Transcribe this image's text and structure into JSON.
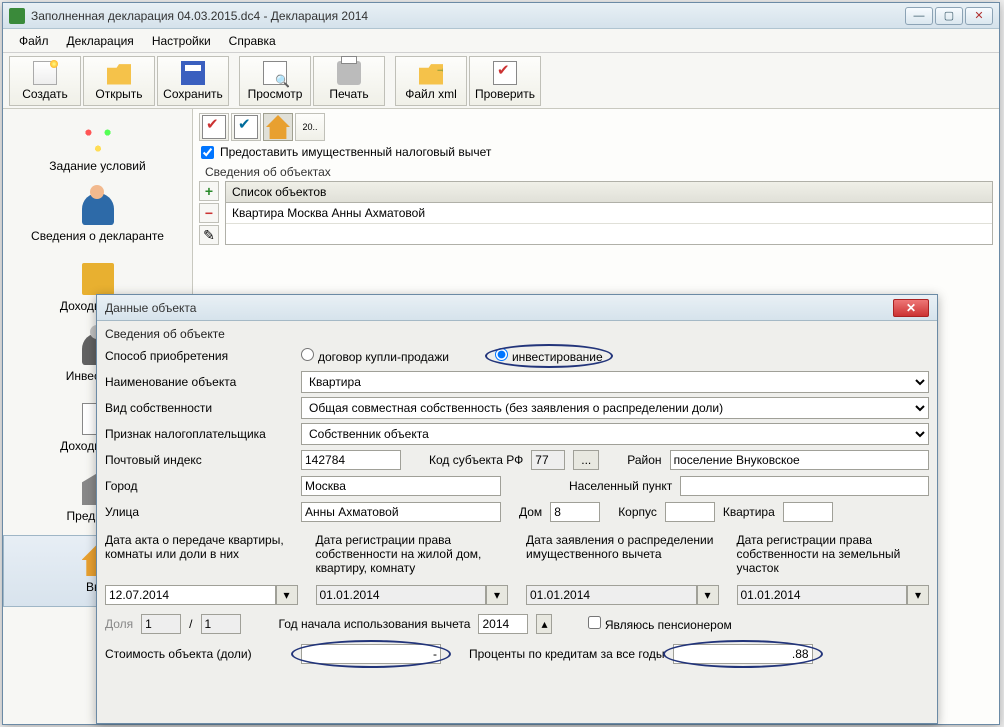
{
  "window": {
    "title": "Заполненная декларация 04.03.2015.dc4 - Декларация 2014"
  },
  "menu": {
    "file": "Файл",
    "decl": "Декларация",
    "settings": "Настройки",
    "help": "Справка"
  },
  "toolbar": {
    "create": "Создать",
    "open": "Открыть",
    "save": "Сохранить",
    "preview": "Просмотр",
    "print": "Печать",
    "xml": "Файл xml",
    "check": "Проверить"
  },
  "sidebar": {
    "items": [
      {
        "label": "Задание условий"
      },
      {
        "label": "Сведения о декларанте"
      },
      {
        "label": "Доходы, полу"
      },
      {
        "label": "Инвест. тов"
      },
      {
        "label": "Доходы за пр"
      },
      {
        "label": "Предприни"
      },
      {
        "label": "Выч"
      }
    ]
  },
  "content": {
    "mini20": "20..",
    "provide_deduction": "Предоставить имущественный налоговый вычет",
    "objects_label": "Сведения об объектах",
    "list_header": "Список объектов",
    "list_row": "Квартира Москва  Анны Ахматовой"
  },
  "dialog": {
    "title": "Данные объекта",
    "group": "Сведения об объекте",
    "acq_label": "Способ приобретения",
    "acq_opt1": "договор купли-продажи",
    "acq_opt2": "инвестирование",
    "name_label": "Наименование объекта",
    "name_value": "Квартира",
    "ownership_label": "Вид собственности",
    "ownership_value": "Общая совместная собственность (без заявления о распределении доли)",
    "taxpayer_label": "Признак налогоплательщика",
    "taxpayer_value": "Собственник объекта",
    "postcode_label": "Почтовый индекс",
    "postcode": "142784",
    "region_code_label": "Код субъекта РФ",
    "region_code": "77",
    "district_label": "Район",
    "district": "поселение Внуковское",
    "city_label": "Город",
    "city": "Москва",
    "settlement_label": "Населенный пункт",
    "settlement": "",
    "street_label": "Улица",
    "street": "Анны Ахматовой",
    "house_label": "Дом",
    "house": "8",
    "building_label": "Корпус",
    "building": "",
    "flat_label": "Квартира",
    "flat": "",
    "date1_label": "Дата акта о передаче квартиры, комнаты или доли в них",
    "date2_label": "Дата регистрации права собственности на жилой дом, квартиру, комнату",
    "date3_label": "Дата заявления о распределении имущественного вычета",
    "date4_label": "Дата регистрации права собственности на земельный участок",
    "date1": "12.07.2014",
    "date2": "01.01.2014",
    "date3": "01.01.2014",
    "date4": "01.01.2014",
    "share_label": "Доля",
    "share_a": "1",
    "share_b": "1",
    "year_use_label": "Год начала использования вычета",
    "year_use": "2014",
    "pensioner": "Являюсь пенсионером",
    "cost_label": "Стоимость объекта (доли)",
    "cost": "-",
    "interest_label": "Проценты по кредитам за все годы",
    "interest": ".88"
  }
}
